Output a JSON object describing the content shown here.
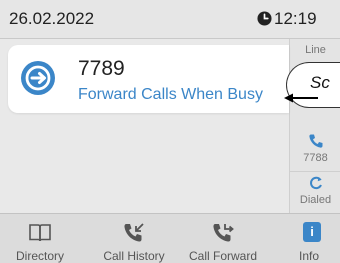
{
  "status": {
    "date": "26.02.2022",
    "time": "12:19"
  },
  "line_keys": [
    {
      "label": "Line"
    },
    {
      "label": "7788"
    },
    {
      "label": "Dialed"
    }
  ],
  "card": {
    "number": "7789",
    "subtitle": "Forward Calls When Busy"
  },
  "callout": {
    "text": "Sc"
  },
  "tabs": [
    {
      "label": "Directory",
      "icon": "book-icon"
    },
    {
      "label": "Call History",
      "icon": "call-history-icon"
    },
    {
      "label": "Call Forward",
      "icon": "call-forward-icon"
    },
    {
      "label": "Info",
      "icon": "info-icon"
    }
  ],
  "colors": {
    "accent": "#3b86c8",
    "card_bg": "#ffffff",
    "background": "#e9e9e9"
  }
}
